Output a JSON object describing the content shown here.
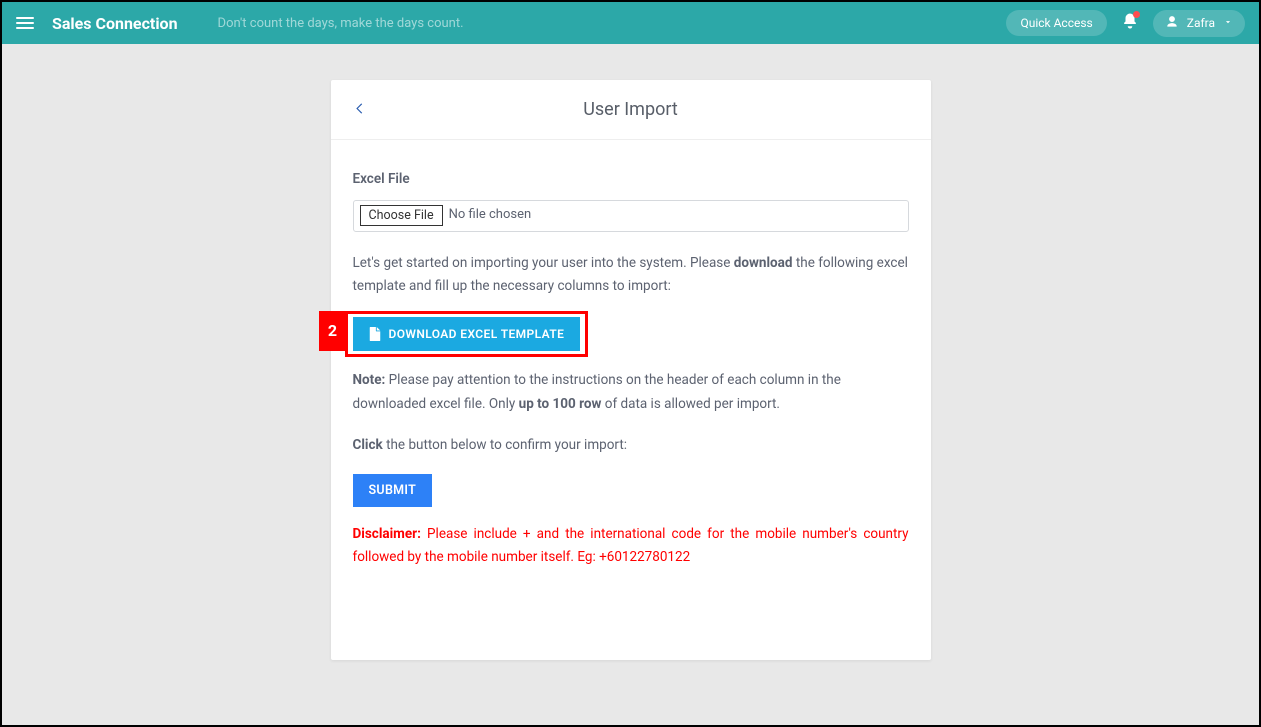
{
  "header": {
    "brand": "Sales Connection",
    "tagline": "Don't count the days, make the days count.",
    "quick_access_label": "Quick Access",
    "user_name": "Zafra"
  },
  "card": {
    "title": "User Import",
    "field_label": "Excel File",
    "choose_file_label": "Choose File",
    "file_status": "No file chosen",
    "intro_prefix": "Let's get started on importing your user into the system. Please ",
    "intro_bold": "download",
    "intro_suffix": " the following excel template and fill up the necessary columns to import:",
    "step_badge": "2",
    "download_label": "DOWNLOAD EXCEL TEMPLATE",
    "note_label": "Note:",
    "note_text_1": " Please pay attention to the instructions on the header of each column in the downloaded excel file. Only ",
    "note_bold": "up to 100 row",
    "note_text_2": " of data is allowed per import.",
    "click_label": "Click",
    "click_text": " the button below to confirm your import:",
    "submit_label": "SUBMIT",
    "disclaimer_label": "Disclaimer:",
    "disclaimer_text": " Please include + and the international code for the mobile number's country followed by the mobile number itself. Eg: +60122780122"
  }
}
